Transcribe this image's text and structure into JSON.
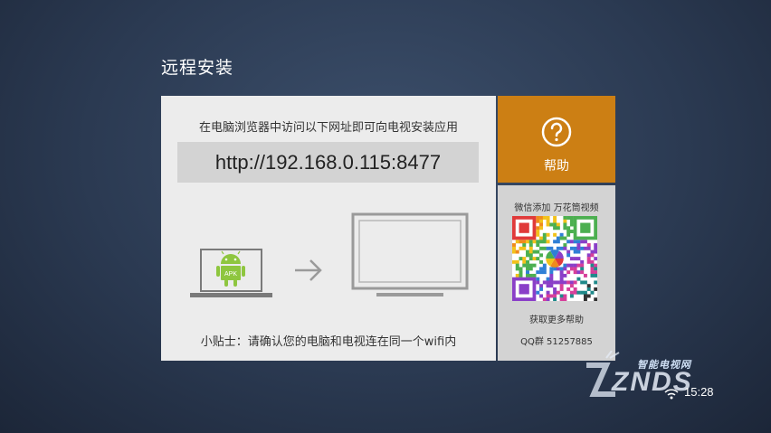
{
  "page": {
    "title": "远程安装"
  },
  "main": {
    "instruction": "在电脑浏览器中访问以下网址即可向电视安装应用",
    "url": "http://192.168.0.115:8477",
    "apk_label": "APK",
    "tip": "小贴士：请确认您的电脑和电视连在同一个wifi内"
  },
  "help": {
    "label": "帮助",
    "icon": "question-circle-icon"
  },
  "wechat": {
    "title": "微信添加 万花筒视频",
    "more_help": "获取更多帮助",
    "qq_group": "QQ群 51257885"
  },
  "status": {
    "time": "15:28"
  },
  "watermark": {
    "logo": "ZNDS",
    "subtitle": "智能电视网"
  },
  "colors": {
    "help_tile": "#cc7f14",
    "android_green": "#8ec63f"
  }
}
